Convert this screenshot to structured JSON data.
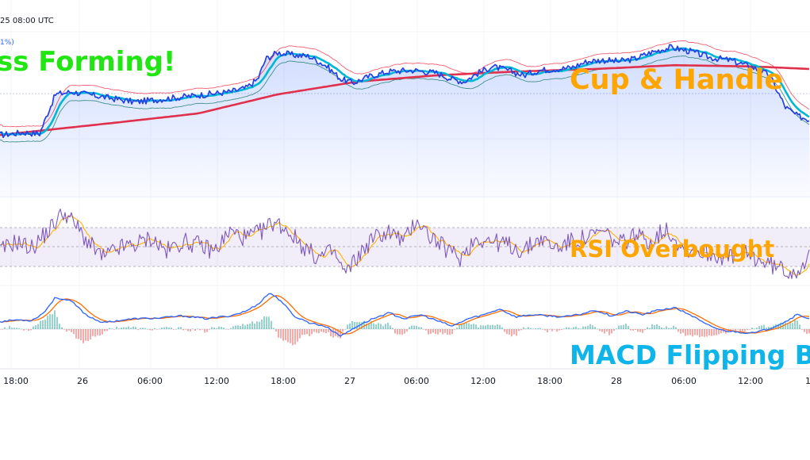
{
  "header": {
    "date_text": "25 08:00 UTC",
    "pct_text": "1%)"
  },
  "annotations": {
    "cross": "ss Forming!",
    "cup": "Cup & Handle",
    "rsi": "RSI Overbought",
    "macd": "MACD Flipping B"
  },
  "colors": {
    "price": "#2440e6",
    "ema": "#00b8d4",
    "sma": "#e0304b",
    "bb": "#f0364f",
    "rsi": "#7e57c2",
    "rsi_ma": "#ffb300",
    "macd": "#2962ff",
    "signal": "#ff6d00",
    "ann_green": "#22e614",
    "ann_orange": "#ffa500",
    "ann_blue": "#0fb4e8"
  },
  "chart_data": [
    {
      "type": "line",
      "panel": "price",
      "x_tick_labels": [
        "18:00",
        "26",
        "06:00",
        "12:00",
        "18:00",
        "27",
        "06:00",
        "12:00",
        "18:00",
        "28",
        "06:00",
        "12:00",
        "1"
      ],
      "series": [],
      "price_path": [
        [
          0,
          0.28
        ],
        [
          30,
          0.3
        ],
        [
          50,
          0.29
        ],
        [
          60,
          0.45
        ],
        [
          70,
          0.6
        ],
        [
          90,
          0.62
        ],
        [
          110,
          0.6
        ],
        [
          140,
          0.57
        ],
        [
          170,
          0.54
        ],
        [
          200,
          0.56
        ],
        [
          230,
          0.58
        ],
        [
          260,
          0.6
        ],
        [
          290,
          0.62
        ],
        [
          310,
          0.65
        ],
        [
          325,
          0.72
        ],
        [
          335,
          0.88
        ],
        [
          350,
          0.93
        ],
        [
          370,
          0.91
        ],
        [
          390,
          0.9
        ],
        [
          410,
          0.83
        ],
        [
          430,
          0.72
        ],
        [
          445,
          0.69
        ],
        [
          465,
          0.74
        ],
        [
          490,
          0.78
        ],
        [
          520,
          0.79
        ],
        [
          550,
          0.77
        ],
        [
          570,
          0.72
        ],
        [
          585,
          0.7
        ],
        [
          600,
          0.76
        ],
        [
          620,
          0.82
        ],
        [
          640,
          0.79
        ],
        [
          660,
          0.75
        ],
        [
          680,
          0.79
        ],
        [
          700,
          0.8
        ],
        [
          720,
          0.81
        ],
        [
          740,
          0.86
        ],
        [
          760,
          0.87
        ],
        [
          780,
          0.86
        ],
        [
          800,
          0.88
        ],
        [
          820,
          0.93
        ],
        [
          845,
          0.97
        ],
        [
          870,
          0.94
        ],
        [
          895,
          0.89
        ],
        [
          920,
          0.87
        ],
        [
          950,
          0.81
        ],
        [
          970,
          0.75
        ],
        [
          990,
          0.5
        ],
        [
          1005,
          0.43
        ],
        [
          1021,
          0.4
        ]
      ],
      "sma_path": [
        [
          0,
          0.28
        ],
        [
          150,
          0.38
        ],
        [
          250,
          0.45
        ],
        [
          350,
          0.6
        ],
        [
          450,
          0.7
        ],
        [
          550,
          0.75
        ],
        [
          650,
          0.78
        ],
        [
          750,
          0.8
        ],
        [
          850,
          0.83
        ],
        [
          950,
          0.82
        ],
        [
          1021,
          0.8
        ]
      ]
    },
    {
      "type": "line",
      "panel": "rsi",
      "rsi_path": [
        [
          0,
          0.4
        ],
        [
          20,
          0.55
        ],
        [
          40,
          0.45
        ],
        [
          60,
          0.7
        ],
        [
          80,
          1.0
        ],
        [
          95,
          0.8
        ],
        [
          110,
          0.55
        ],
        [
          130,
          0.3
        ],
        [
          150,
          0.45
        ],
        [
          170,
          0.5
        ],
        [
          190,
          0.6
        ],
        [
          210,
          0.4
        ],
        [
          230,
          0.55
        ],
        [
          250,
          0.5
        ],
        [
          270,
          0.4
        ],
        [
          290,
          0.7
        ],
        [
          310,
          0.6
        ],
        [
          330,
          0.7
        ],
        [
          345,
          0.85
        ],
        [
          360,
          0.75
        ],
        [
          380,
          0.5
        ],
        [
          400,
          0.3
        ],
        [
          420,
          0.4
        ],
        [
          435,
          0.05
        ],
        [
          450,
          0.3
        ],
        [
          470,
          0.6
        ],
        [
          490,
          0.7
        ],
        [
          510,
          0.55
        ],
        [
          525,
          0.9
        ],
        [
          540,
          0.65
        ],
        [
          560,
          0.45
        ],
        [
          580,
          0.3
        ],
        [
          600,
          0.6
        ],
        [
          620,
          0.55
        ],
        [
          640,
          0.5
        ],
        [
          660,
          0.4
        ],
        [
          680,
          0.6
        ],
        [
          700,
          0.45
        ],
        [
          720,
          0.55
        ],
        [
          740,
          0.6
        ],
        [
          760,
          0.7
        ],
        [
          780,
          0.5
        ],
        [
          800,
          0.65
        ],
        [
          820,
          0.55
        ],
        [
          840,
          0.75
        ],
        [
          860,
          0.45
        ],
        [
          880,
          0.4
        ],
        [
          900,
          0.35
        ],
        [
          920,
          0.3
        ],
        [
          940,
          0.35
        ],
        [
          960,
          0.25
        ],
        [
          980,
          0.15
        ],
        [
          1000,
          0.08
        ],
        [
          1021,
          0.3
        ]
      ]
    },
    {
      "type": "line",
      "panel": "macd",
      "macd_path": [
        [
          0,
          0.5
        ],
        [
          20,
          0.53
        ],
        [
          40,
          0.52
        ],
        [
          55,
          0.65
        ],
        [
          70,
          0.92
        ],
        [
          90,
          0.85
        ],
        [
          110,
          0.6
        ],
        [
          130,
          0.48
        ],
        [
          150,
          0.52
        ],
        [
          170,
          0.55
        ],
        [
          200,
          0.56
        ],
        [
          230,
          0.6
        ],
        [
          260,
          0.55
        ],
        [
          290,
          0.6
        ],
        [
          310,
          0.68
        ],
        [
          325,
          0.8
        ],
        [
          340,
          1.0
        ],
        [
          355,
          0.85
        ],
        [
          370,
          0.6
        ],
        [
          390,
          0.48
        ],
        [
          410,
          0.42
        ],
        [
          430,
          0.25
        ],
        [
          450,
          0.42
        ],
        [
          470,
          0.55
        ],
        [
          490,
          0.65
        ],
        [
          510,
          0.55
        ],
        [
          530,
          0.62
        ],
        [
          550,
          0.52
        ],
        [
          570,
          0.42
        ],
        [
          590,
          0.55
        ],
        [
          610,
          0.62
        ],
        [
          630,
          0.72
        ],
        [
          650,
          0.58
        ],
        [
          670,
          0.62
        ],
        [
          690,
          0.6
        ],
        [
          710,
          0.58
        ],
        [
          730,
          0.62
        ],
        [
          750,
          0.7
        ],
        [
          770,
          0.6
        ],
        [
          790,
          0.68
        ],
        [
          810,
          0.62
        ],
        [
          830,
          0.7
        ],
        [
          850,
          0.74
        ],
        [
          870,
          0.62
        ],
        [
          890,
          0.45
        ],
        [
          910,
          0.35
        ],
        [
          930,
          0.32
        ],
        [
          950,
          0.3
        ],
        [
          970,
          0.38
        ],
        [
          990,
          0.5
        ],
        [
          1005,
          0.62
        ],
        [
          1021,
          0.55
        ]
      ]
    }
  ]
}
